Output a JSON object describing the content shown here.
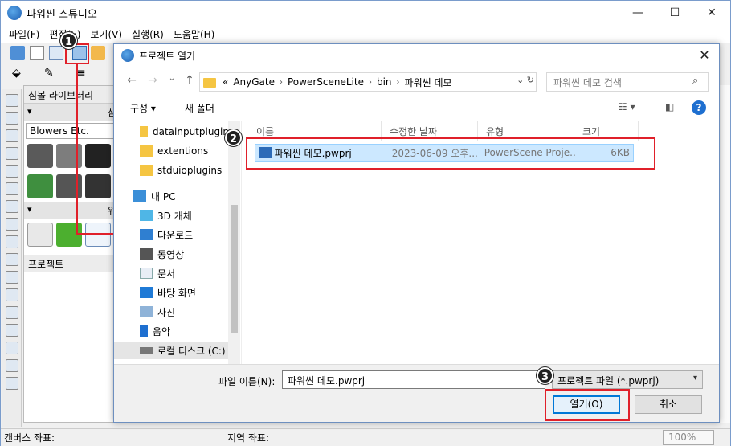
{
  "app": {
    "title": "파워씬 스튜디오",
    "window_controls": [
      "—",
      "☐",
      "✕"
    ]
  },
  "menu": [
    "파일(F)",
    "편집(E)",
    "보기(V)",
    "실행(R)",
    "도움말(H)"
  ],
  "symbol_panel": {
    "header": "심볼 라이브러리",
    "section1": "심",
    "combo_value": "Blowers Etc.",
    "section2": "위"
  },
  "project_panel": {
    "header": "프로젝트"
  },
  "statusbar": {
    "canvas_coords": "캔버스 좌표:",
    "region_coords": "지역 좌표:",
    "zoom": "100%"
  },
  "dialog": {
    "title": "프로젝트 열기",
    "close": "✕",
    "breadcrumb": [
      "AnyGate",
      "PowerSceneLite",
      "bin",
      "파워씬 데모"
    ],
    "breadcrumb_prefix": "«",
    "search_placeholder": "파워씬 데모 검색",
    "organize": "구성 ▾",
    "new_folder": "새 폴더",
    "help": "?",
    "nav_items": [
      {
        "label": "datainputplugin"
      },
      {
        "label": "extentions"
      },
      {
        "label": "stduioplugins"
      },
      {
        "label": "내 PC"
      },
      {
        "label": "3D 개체"
      },
      {
        "label": "다운로드"
      },
      {
        "label": "동영상"
      },
      {
        "label": "문서"
      },
      {
        "label": "바탕 화면"
      },
      {
        "label": "사진"
      },
      {
        "label": "음악"
      },
      {
        "label": "로컬 디스크 (C:)"
      }
    ],
    "columns": [
      "이름",
      "수정한 날짜",
      "유형",
      "크기"
    ],
    "files": [
      {
        "name": "파워씬 데모.pwprj",
        "date": "2023-06-09 오후...",
        "type": "PowerScene Proje...",
        "size": "6KB"
      }
    ],
    "filename_label": "파일 이름(N):",
    "filename_value": "파워씬 데모.pwprj",
    "filetype_value": "프로젝트 파일 (*.pwprj)",
    "open_label": "열기(O)",
    "cancel_label": "취소"
  },
  "annotations": {
    "step1": "1",
    "step2": "2",
    "step3": "3",
    "color": "#e0202a"
  }
}
